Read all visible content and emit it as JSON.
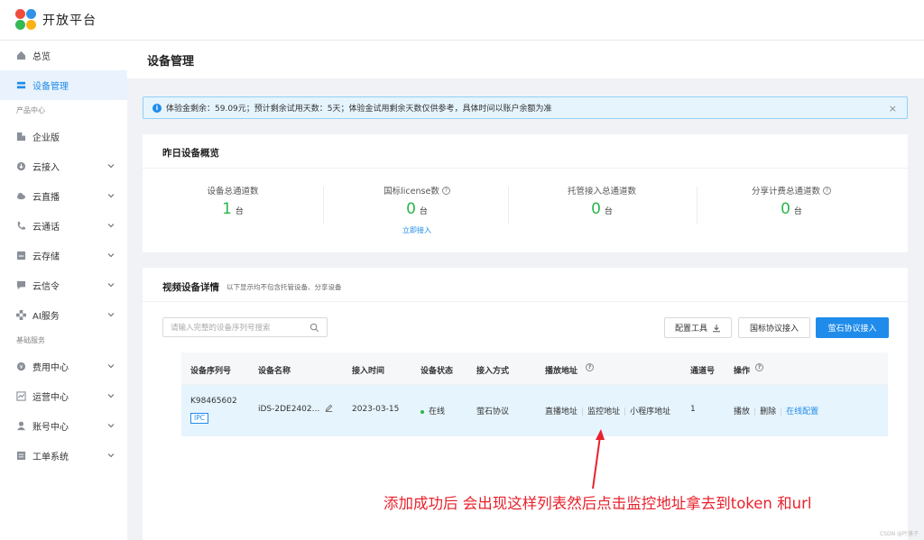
{
  "app": {
    "title": "开放平台"
  },
  "sidebar": {
    "items_top": [
      {
        "label": "总览",
        "icon": "dashboard-icon"
      },
      {
        "label": "设备管理",
        "icon": "device-list-icon",
        "active": true
      }
    ],
    "group_product": "产品中心",
    "items_product": [
      {
        "label": "企业版",
        "icon": "building-icon"
      },
      {
        "label": "云接入",
        "icon": "cloud-download-icon"
      },
      {
        "label": "云直播",
        "icon": "cloud-icon"
      },
      {
        "label": "云通话",
        "icon": "phone-icon"
      },
      {
        "label": "云存储",
        "icon": "storage-icon"
      },
      {
        "label": "云信令",
        "icon": "message-icon"
      },
      {
        "label": "AI服务",
        "icon": "ai-icon"
      }
    ],
    "group_basic": "基础服务",
    "items_basic": [
      {
        "label": "费用中心",
        "icon": "money-icon"
      },
      {
        "label": "运营中心",
        "icon": "chart-icon"
      },
      {
        "label": "账号中心",
        "icon": "user-icon"
      },
      {
        "label": "工单系统",
        "icon": "ticket-icon"
      }
    ]
  },
  "header": {
    "title": "设备管理"
  },
  "alert": {
    "text": "体验金剩余：59.09元；预计剩余试用天数：5天；体验金试用剩余天数仅供参考，具体时间以账户余额为准",
    "close": "×"
  },
  "overview": {
    "title": "昨日设备概览",
    "stats": [
      {
        "label": "设备总通道数",
        "value": "1",
        "unit": "台",
        "help": false
      },
      {
        "label": "国标license数",
        "value": "0",
        "unit": "台",
        "help": true,
        "link": "立即接入"
      },
      {
        "label": "托管接入总通道数",
        "value": "0",
        "unit": "台",
        "help": false
      },
      {
        "label": "分享计费总通道数",
        "value": "0",
        "unit": "台",
        "help": true
      }
    ]
  },
  "details": {
    "title": "视频设备详情",
    "subtitle": "以下显示均不包含托管设备、分享设备",
    "search_placeholder": "请输入完整的设备序列号搜索",
    "buttons": {
      "config_tool": "配置工具",
      "gb_access": "国标协议接入",
      "ys_access": "萤石协议接入"
    },
    "columns": [
      "设备序列号",
      "设备名称",
      "接入时间",
      "设备状态",
      "接入方式",
      "播放地址",
      "通道号",
      "操作"
    ],
    "rows": [
      {
        "serial": "K98465602",
        "tag": "IPC",
        "name": "iDS-2DE2402...",
        "time": "2023-03-15",
        "status": "在线",
        "method": "萤石协议",
        "play_live": "直播地址",
        "play_monitor": "监控地址",
        "play_mini": "小程序地址",
        "channel": "1",
        "op_play": "播放",
        "op_delete": "删除",
        "op_config": "在线配置"
      }
    ]
  },
  "annotation": "添加成功后 会出现这样列表然后点击监控地址拿去到token 和url",
  "watermark": "CSDN @叶落子"
}
